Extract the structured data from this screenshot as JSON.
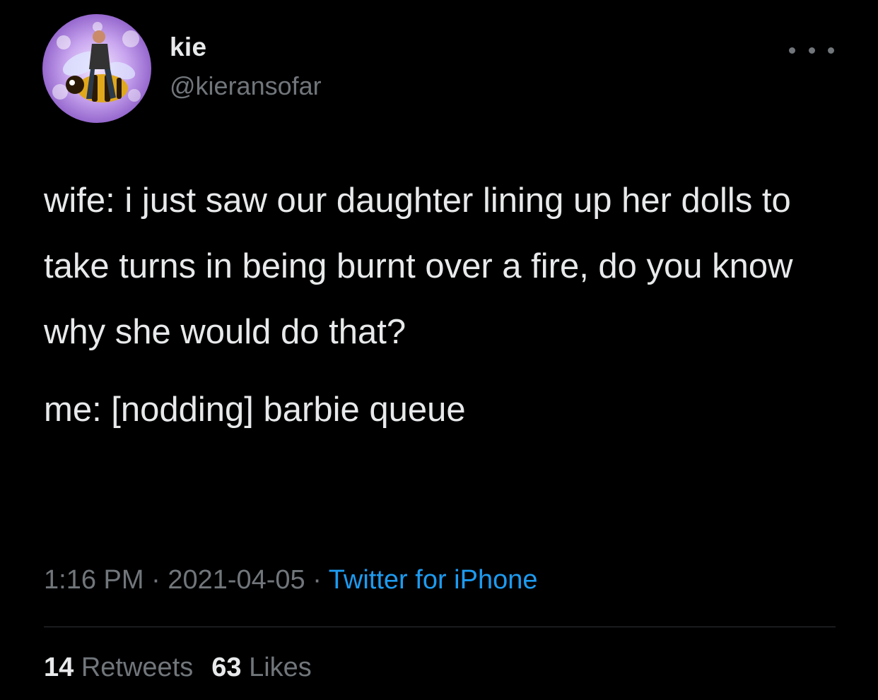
{
  "author": {
    "display_name": "kie",
    "handle": "@kieransofar",
    "avatar_icon": "avatar-man-riding-bee"
  },
  "more_icon": "more-horizontal-icon",
  "tweet": {
    "paragraphs": [
      "wife: i just saw our daughter lining up her dolls to take turns in being burnt over a fire, do you know why she would do that?",
      "me: [nodding] barbie queue"
    ]
  },
  "meta": {
    "time": "1:16 PM",
    "sep1": " · ",
    "date": "2021-04-05",
    "sep2": " · ",
    "source": "Twitter for iPhone"
  },
  "stats": {
    "retweets_count": "14",
    "retweets_label": "Retweets",
    "likes_count": "63",
    "likes_label": "Likes"
  },
  "colors": {
    "background": "#000000",
    "text": "#e7e9ea",
    "secondary": "#71767b",
    "link": "#1d9bf0",
    "divider": "#2f3336"
  }
}
